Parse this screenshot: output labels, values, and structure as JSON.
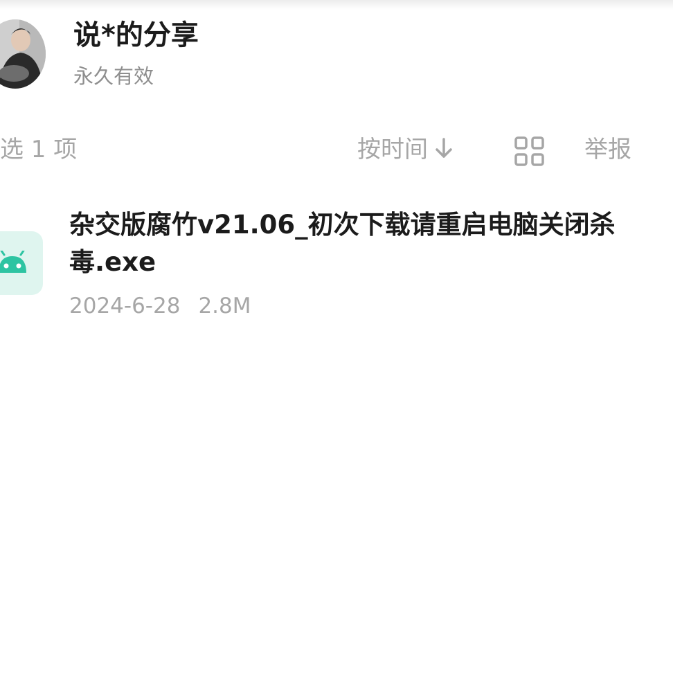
{
  "header": {
    "sharer_name": "说*的分享",
    "validity": "永久有效"
  },
  "toolbar": {
    "selected_count": "选 1 项",
    "sort_label": "按时间",
    "sort_icon": "arrow-down-icon",
    "grid_icon": "grid-view-icon",
    "report_label": "举报"
  },
  "files": [
    {
      "name": "杂交版腐竹v21.06_初次下载请重启电脑关闭杀毒.exe",
      "date": "2024-6-28",
      "size": "2.8M",
      "icon": "android-icon"
    }
  ],
  "colors": {
    "primary_text": "#1b1b1b",
    "secondary_text": "#a6a6a6",
    "icon_bg": "#dff5ef",
    "icon_accent": "#2ec4a2"
  }
}
